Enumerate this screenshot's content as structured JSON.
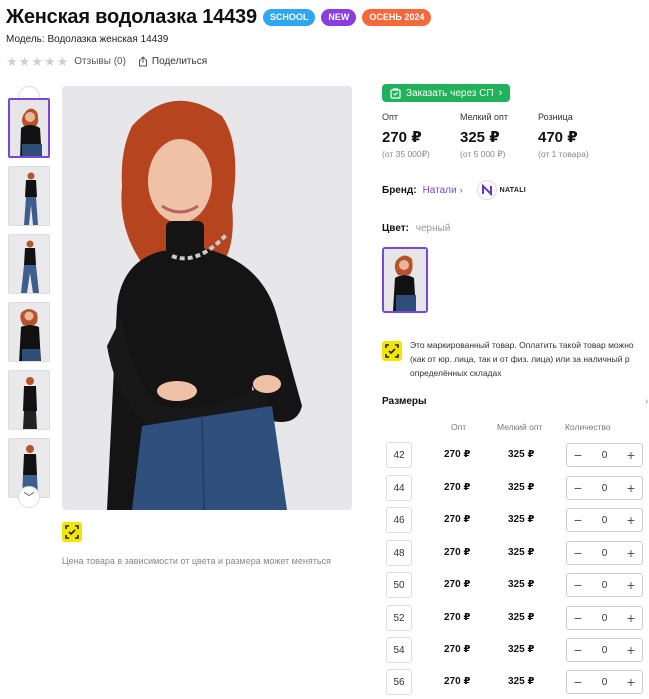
{
  "product": {
    "title": "Женская водолазка 14439",
    "badges": [
      "SCHOOL",
      "NEW",
      "ОСЕНЬ 2024"
    ],
    "model": "Модель: Водолазка женская 14439",
    "reviews": "Отзывы (0)",
    "share": "Поделиться"
  },
  "gallery": {
    "note": "Цена товара в зависимости от цвета и размера может меняться"
  },
  "order_button": "Заказать через СП",
  "prices": [
    {
      "label": "Опт",
      "value": "270 ₽",
      "sub": "(от 35 000₽)"
    },
    {
      "label": "Мелкий опт",
      "value": "325 ₽",
      "sub": "(от 5 000 ₽)"
    },
    {
      "label": "Розница",
      "value": "470 ₽",
      "sub": "(от 1 товара)"
    }
  ],
  "brand": {
    "label": "Бренд:",
    "name": "Натали",
    "logo_text": "NATALI"
  },
  "color": {
    "label": "Цвет:",
    "value": "черный"
  },
  "marking": {
    "lines": [
      "Это маркированный товар. Оплатить такой товар можно",
      "(как от юр. лица, так и от физ. лица) или за наличный р",
      "определённых складах"
    ]
  },
  "sizes": {
    "title": "Размеры",
    "more": "›",
    "headers": {
      "opt": "Опт",
      "small": "Мелкий опт",
      "qty": "Количество"
    },
    "rows": [
      {
        "size": "42",
        "opt": "270 ₽",
        "small": "325 ₽",
        "qty": "0"
      },
      {
        "size": "44",
        "opt": "270 ₽",
        "small": "325 ₽",
        "qty": "0"
      },
      {
        "size": "46",
        "opt": "270 ₽",
        "small": "325 ₽",
        "qty": "0"
      },
      {
        "size": "48",
        "opt": "270 ₽",
        "small": "325 ₽",
        "qty": "0"
      },
      {
        "size": "50",
        "opt": "270 ₽",
        "small": "325 ₽",
        "qty": "0"
      },
      {
        "size": "52",
        "opt": "270 ₽",
        "small": "325 ₽",
        "qty": "0"
      },
      {
        "size": "54",
        "opt": "270 ₽",
        "small": "325 ₽",
        "qty": "0"
      },
      {
        "size": "56",
        "opt": "270 ₽",
        "small": "325 ₽",
        "qty": "0"
      }
    ]
  },
  "colors": {
    "accent": "#7b47d9",
    "order_green": "#21b15a",
    "marking_yellow": "#f2e600"
  }
}
